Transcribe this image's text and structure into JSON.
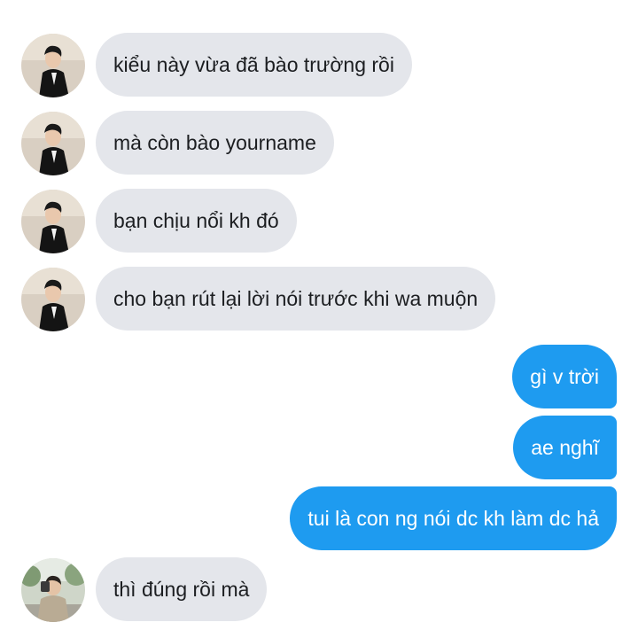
{
  "conversation": {
    "messages": [
      {
        "sender": "other",
        "avatar": "avatar-man-black-suit",
        "text": "kiểu này vừa đã bào trường rồi"
      },
      {
        "sender": "other",
        "avatar": "avatar-man-black-suit",
        "text": "mà còn bào yourname"
      },
      {
        "sender": "other",
        "avatar": "avatar-man-black-suit",
        "text": "bạn chịu nổi kh đó"
      },
      {
        "sender": "other",
        "avatar": "avatar-man-black-suit",
        "text": "cho bạn rút lại lời nói trước khi wa muộn"
      },
      {
        "sender": "me",
        "text": "gì v trời"
      },
      {
        "sender": "me",
        "text": "ae nghĩ"
      },
      {
        "sender": "me",
        "text": "tui là con ng nói dc kh làm dc hả"
      },
      {
        "sender": "other",
        "avatar": "avatar-outdoor-selfie",
        "text": "thì đúng rồi mà"
      }
    ]
  },
  "colors": {
    "incoming_bubble": "#e4e6eb",
    "incoming_text": "#1c1e21",
    "outgoing_bubble": "#1e9bf0",
    "outgoing_text": "#ffffff",
    "background": "#ffffff"
  }
}
